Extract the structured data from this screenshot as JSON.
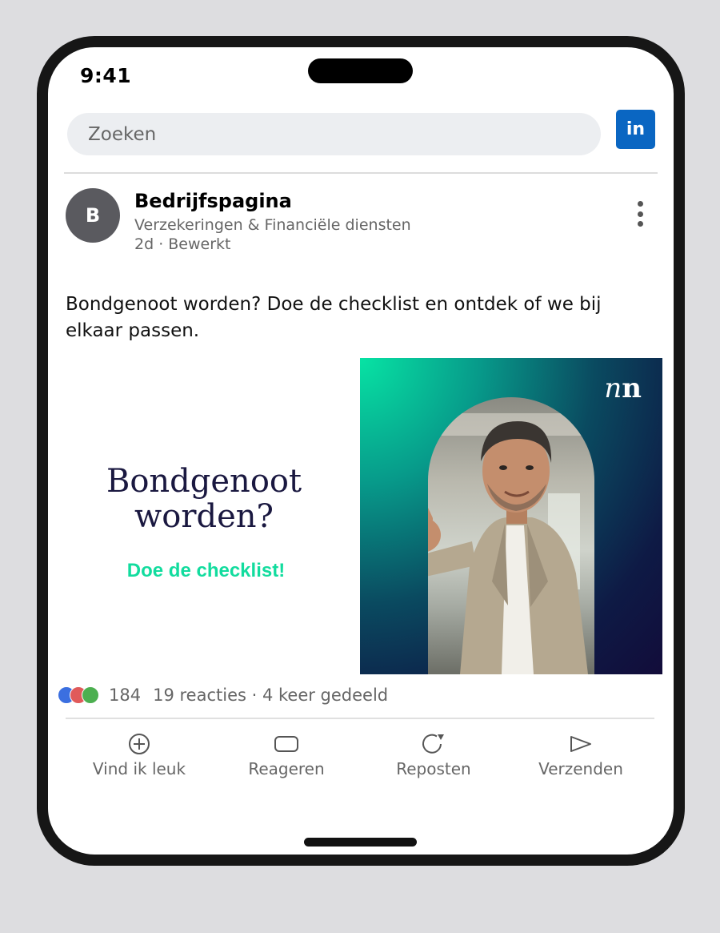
{
  "status": {
    "time": "9:41"
  },
  "search": {
    "placeholder": "Zoeken"
  },
  "linkedin": {
    "logo_text": "in",
    "brand_color": "#0a66c2"
  },
  "post": {
    "avatar_initial": "B",
    "company_name": "Bedrijfspagina",
    "company_subtitle": "Verzekeringen & Financiële diensten",
    "meta": "2d · Bewerkt",
    "text": "Bondgenoot worden? Doe de checklist en ontdek of we bij elkaar passen."
  },
  "ad": {
    "headline_line1": "Bondgenoot",
    "headline_line2": "worden?",
    "cta": "Doe de checklist!",
    "cta_color": "#12dc9e",
    "brand_logo": "nn"
  },
  "engagement": {
    "reaction_count": "184",
    "summary": "19 reacties · 4 keer gedeeld",
    "reaction_colors": [
      "#3b6fe0",
      "#e05a5a",
      "#4caf50"
    ]
  },
  "actions": [
    {
      "label": "Vind ik leuk",
      "icon": "plus-circle-icon"
    },
    {
      "label": "Reageren",
      "icon": "comment-icon"
    },
    {
      "label": "Reposten",
      "icon": "repost-icon"
    },
    {
      "label": "Verzenden",
      "icon": "send-icon"
    }
  ]
}
